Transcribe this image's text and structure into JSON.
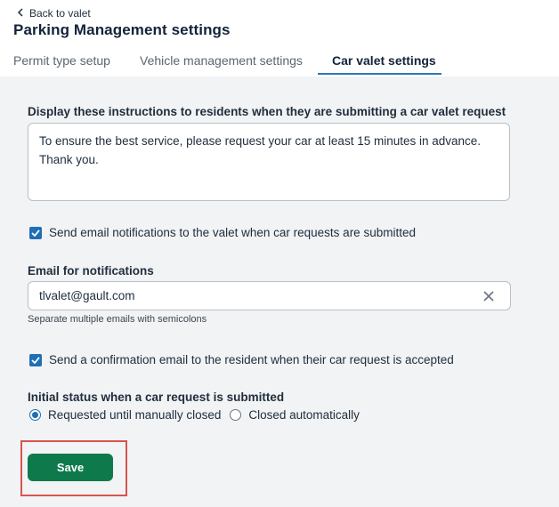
{
  "header": {
    "back_label": "Back to valet",
    "title": "Parking Management settings"
  },
  "tabs": [
    {
      "label": "Permit type setup",
      "active": false
    },
    {
      "label": "Vehicle management settings",
      "active": false
    },
    {
      "label": "Car valet settings",
      "active": true
    }
  ],
  "form": {
    "instructions_label": "Display these instructions to residents when they are submitting a car valet request",
    "instructions_line1": "To ensure the best service, please request your car at least 15 minutes in advance.",
    "instructions_line2": "Thank you.",
    "notify_valet_label": "Send email notifications to the valet when car requests are submitted",
    "notify_valet_checked": true,
    "email_label": "Email for notifications",
    "email_value": "tlvalet@gault.com",
    "email_helper": "Separate multiple emails with semicolons",
    "confirm_resident_label": "Send a confirmation email to the resident when their car request is accepted",
    "confirm_resident_checked": true,
    "initial_status_label": "Initial status when a car request is submitted",
    "status_options": [
      {
        "label": "Requested until manually closed",
        "selected": true
      },
      {
        "label": "Closed automatically",
        "selected": false
      }
    ],
    "save_label": "Save"
  },
  "colors": {
    "accent": "#1f6fb5",
    "save": "#0e7a4c",
    "highlight": "#d9534f",
    "content_bg": "#f1f3f4"
  }
}
